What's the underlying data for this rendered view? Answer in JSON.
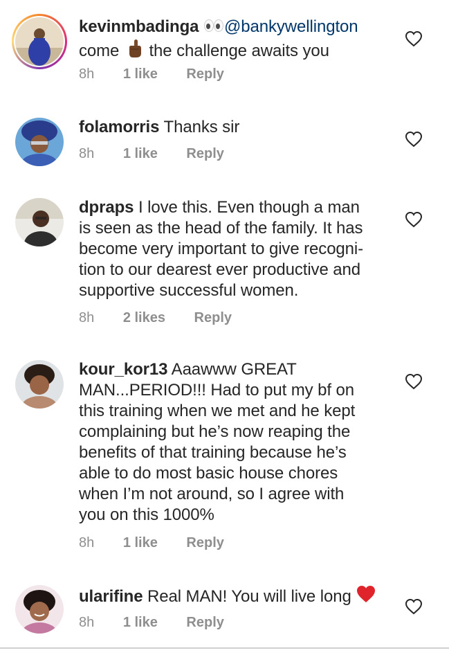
{
  "comments": [
    {
      "username": "kevinmbadinga",
      "mention": "@bankywellington",
      "text_before": "come",
      "text_after": "the challenge awaits you",
      "time": "8h",
      "likes": "1 like",
      "reply": "Reply"
    },
    {
      "username": "folamorris",
      "text": "Thanks sir",
      "time": "8h",
      "likes": "1 like",
      "reply": "Reply"
    },
    {
      "username": "dpraps",
      "line1": "I love this. Even though a man",
      "line2": "is seen as the head of the family. It has",
      "line3": "become very important to give recogni-",
      "line4": "tion to our dearest ever productive and",
      "line5": "supportive successful women.",
      "time": "8h",
      "likes": "2 likes",
      "reply": "Reply"
    },
    {
      "username": "kour_kor13",
      "line1": "Aaawww GREAT",
      "line2": "MAN...PERIOD!!! Had to put my bf on",
      "line3": "this training when we met and he kept",
      "line4": "complaining but he’s now reaping the",
      "line5": "benefits of that training because he’s",
      "line6": "able to do most basic house chores",
      "line7": "when I’m not around, so I agree with",
      "line8": "you on this 1000%",
      "time": "8h",
      "likes": "1 like",
      "reply": "Reply"
    },
    {
      "username": "ularifine",
      "text": "Real MAN! You will live long",
      "time": "8h",
      "likes": "1 like",
      "reply": "Reply"
    }
  ],
  "colors": {
    "text": "#262626",
    "meta": "#8e8e8e",
    "mention": "#00376b",
    "heart_emoji": "#e0242c"
  },
  "icons": [
    "heart-outline-icon",
    "eyes-emoji",
    "pointing-hand-emoji",
    "red-heart-emoji"
  ]
}
